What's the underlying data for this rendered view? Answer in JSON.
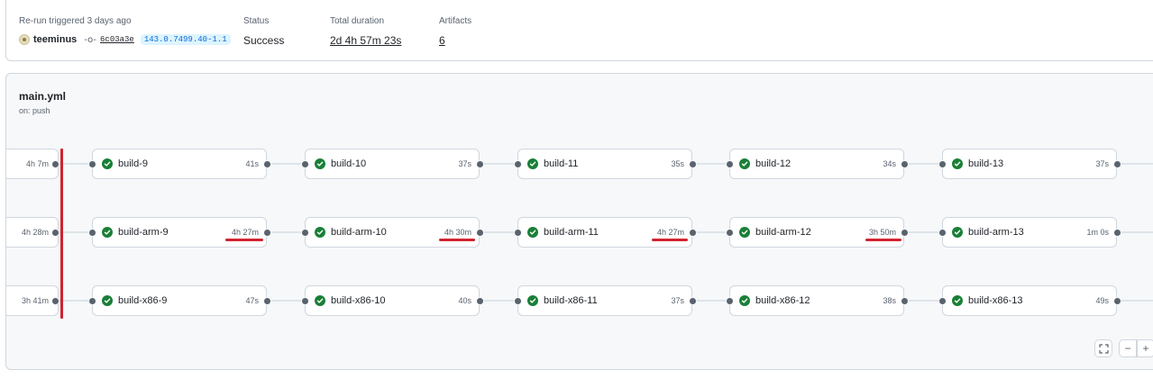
{
  "summary": {
    "rerun_label": "Re-run triggered 3 days ago",
    "actor": "teeminus",
    "commit_sha": "6c03a3e",
    "branch": "143.0.7499.40-1.1",
    "status_label": "Status",
    "status_value": "Success",
    "duration_label": "Total duration",
    "duration_value": "2d 4h 57m 23s",
    "artifacts_label": "Artifacts",
    "artifacts_value": "6"
  },
  "workflow": {
    "file_name": "main.yml",
    "trigger": "on: push"
  },
  "stubs": [
    "4h 7m",
    "4h 28m",
    "3h 41m"
  ],
  "rows": [
    [
      {
        "name": "build-9",
        "duration": "41s"
      },
      {
        "name": "build-10",
        "duration": "37s"
      },
      {
        "name": "build-11",
        "duration": "35s"
      },
      {
        "name": "build-12",
        "duration": "34s"
      },
      {
        "name": "build-13",
        "duration": "37s"
      }
    ],
    [
      {
        "name": "build-arm-9",
        "duration": "4h 27m"
      },
      {
        "name": "build-arm-10",
        "duration": "4h 30m"
      },
      {
        "name": "build-arm-11",
        "duration": "4h 27m"
      },
      {
        "name": "build-arm-12",
        "duration": "3h 50m"
      },
      {
        "name": "build-arm-13",
        "duration": "1m 0s"
      }
    ],
    [
      {
        "name": "build-x86-9",
        "duration": "47s"
      },
      {
        "name": "build-x86-10",
        "duration": "40s"
      },
      {
        "name": "build-x86-11",
        "duration": "37s"
      },
      {
        "name": "build-x86-12",
        "duration": "38s"
      },
      {
        "name": "build-x86-13",
        "duration": "49s"
      }
    ]
  ],
  "controls": {
    "zoom_out": "−",
    "zoom_in": "+"
  },
  "colors": {
    "success": "#1a7f37",
    "annotation": "#d1242f",
    "branch_bg": "#ddf4ff",
    "branch_fg": "#0969da"
  }
}
